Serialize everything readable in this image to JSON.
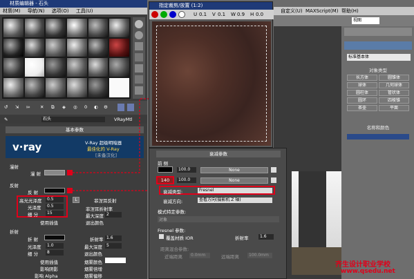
{
  "mat_editor": {
    "title": "材质编辑器 - 石头",
    "menu": [
      "材质(M)",
      "导航(N)",
      "选项(O)",
      "工具(U)"
    ],
    "mat_name": "石头",
    "mat_type": "VRayMtl",
    "rollout_basic": "基本参数",
    "vray_line1": "V-Ray 超级明暗器",
    "vray_line2": "最佳化的 V-Ray",
    "vray_line3": "[未备汉化]",
    "vray_logo": "v·ray"
  },
  "diffuse": {
    "group": "漫射",
    "label": "漫 射"
  },
  "reflection": {
    "group": "反射",
    "label": "反 射",
    "hilight": "高光光泽度",
    "hilight_val": "0.5",
    "gloss": "光泽度",
    "gloss_val": "0.5",
    "subdivs": "细 分",
    "subdivs_val": "15",
    "interp": "使用插值",
    "lock": "L",
    "fresnel": "菲涅耳反射",
    "fresnel_ior": "菲涅耳折射率",
    "max_depth": "最大深度",
    "max_depth_val": "2",
    "exit_color": "退出颜色"
  },
  "refraction": {
    "group": "折射",
    "label": "折 射",
    "gloss": "光泽度",
    "gloss_val": "1.0",
    "subdivs": "细 分",
    "subdivs_val": "8",
    "interp": "使用插值",
    "shadows": "影响阴影",
    "alpha": "影响 Alpha",
    "ior": "折射率",
    "ior_val": "1.6",
    "max_depth": "最大深度",
    "max_depth_val": "5",
    "exit_color": "退出颜色",
    "fog_color": "烟雾颜色",
    "fog_mult": "烟雾倍增",
    "fog_bias": "烟雾偏移"
  },
  "viewer": {
    "title": "指定裁剪/放置 (1:2)",
    "u": "U",
    "u_val": "0.1",
    "v": "V",
    "v_val": "0.1",
    "w": "W",
    "w_val": "0.9",
    "h": "H",
    "h_val": "0.0"
  },
  "falloff": {
    "rollout": "衰减参数",
    "front_side": "前 侧",
    "val1": "100.0",
    "val2": "100.0",
    "none1": "None",
    "none2": "None",
    "highlight": "140",
    "type_label": "衰减类型:",
    "type_val": "Fresnel",
    "dir_label": "衰减方向:",
    "dir_val": "查看方向(摄影机 Z 轴)",
    "mode_rollout": "模式特定参数:",
    "object": "对象",
    "fresnel_params": "Fresnel 参数:",
    "override": "覆盖材质 IOR",
    "ior_label": "折射率",
    "ior_val": "1.6",
    "dist_blend": "距离混合参数:",
    "near": "近端距离",
    "near_val": "0.0mm",
    "far": "远端距离",
    "far_val": "100.0mm"
  },
  "max": {
    "menu": [
      "自定义(U)",
      "MAXScript(M)",
      "帮助(H)"
    ],
    "view": "视图",
    "std_prims": "标准基本体",
    "obj_type": "对象类型",
    "prims": [
      "长方体",
      "圆锥体",
      "球体",
      "几何球体",
      "圆柱体",
      "管状体",
      "圆环",
      "四棱锥",
      "茶壶",
      "平面"
    ],
    "name_color": "名称和颜色"
  },
  "watermark": {
    "line1": "齐生设计职业学校",
    "line2": "www.qsedu.net"
  },
  "colors": {
    "title_blue": "#1f3a78",
    "red": "#e0001a",
    "vray_blue": "#123a66"
  }
}
